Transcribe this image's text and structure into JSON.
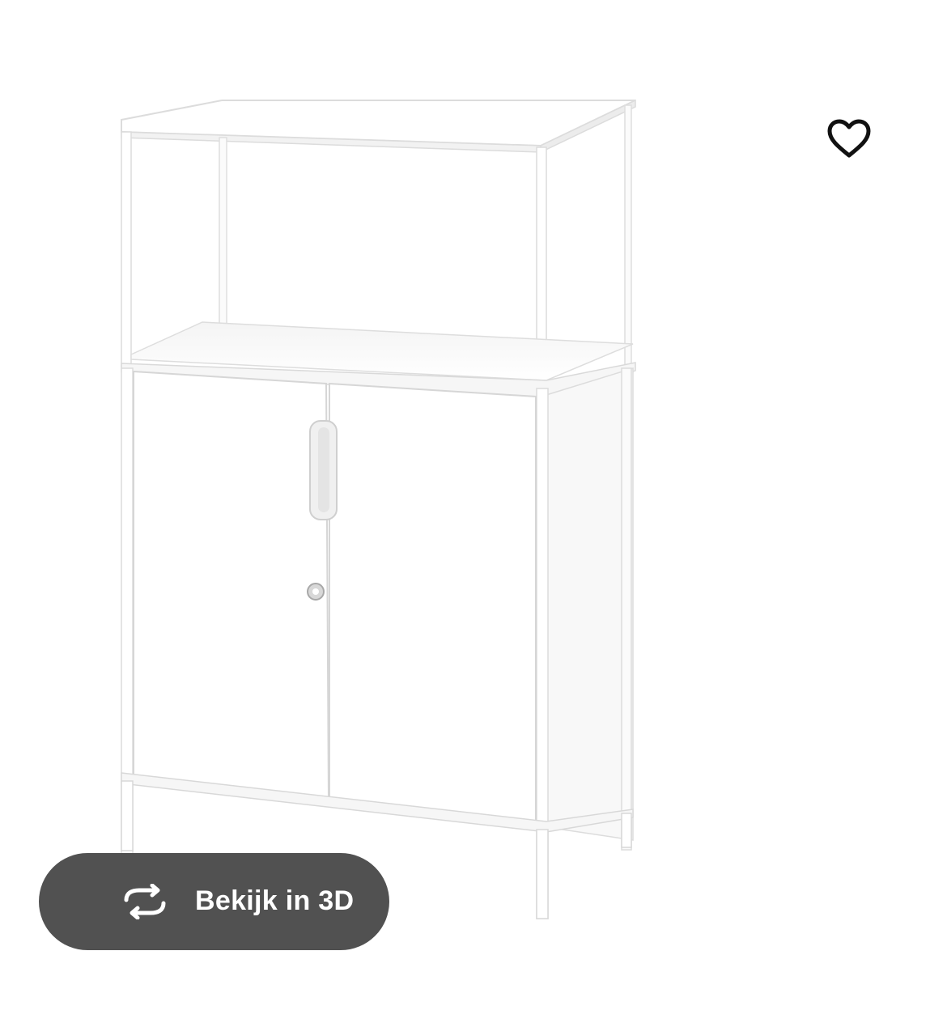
{
  "product": {
    "image_icon": "white-metal-cabinet-with-open-shelf",
    "favorite_icon": "heart-outline-icon"
  },
  "view3d": {
    "label": "Bekijk in 3D",
    "icon": "rotate-arrows-icon",
    "bg_color": "#484848",
    "text_color": "#ffffff"
  }
}
